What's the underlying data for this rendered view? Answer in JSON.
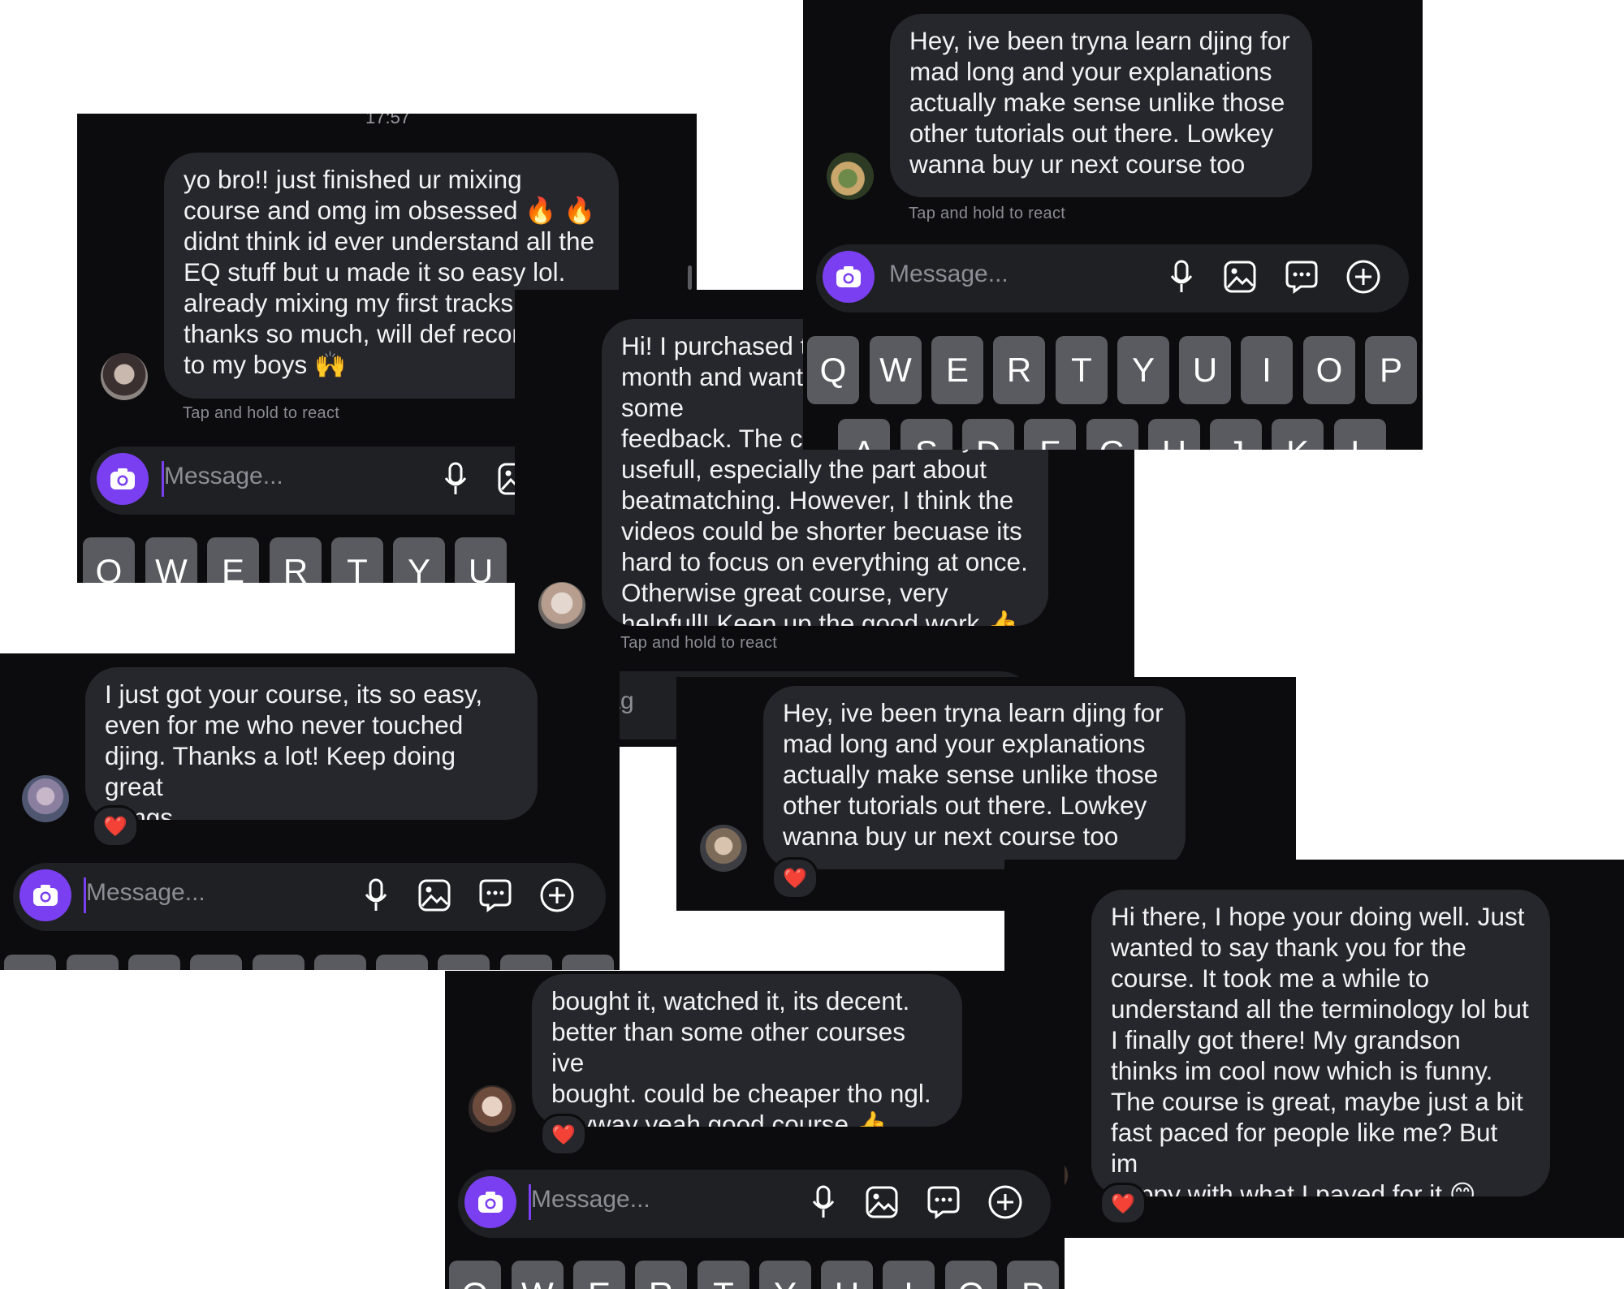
{
  "messages": [
    {
      "text": "yo bro!! just finished ur mixing\ncourse and omg im obsessed 🔥 🔥\ndidnt think id ever understand all the\nEQ stuff but u made it so easy lol.\nalready mixing my first tracks!\nthanks so much, will def recommend\nto my boys 🙌",
      "footer": "Tap and hold to react",
      "time": "17:57"
    },
    {
      "text": "Hey, ive been tryna learn djing for\nmad long and your explanations\nactually make sense unlike those\nother tutorials out there. Lowkey\nwanna buy ur next course too",
      "footer": "Tap and hold to react"
    },
    {
      "text": "Hi! I purchased the course last\nmonth and wanted to give you some\nfeedback. The course was very\nusefull, especially the part about\nbeatmatching. However, I think the\nvideos could be shorter becuase its\nhard to focus on everything at once.\nOtherwise great course, very\nhelpfull! Keep up the good work 👍",
      "footer": "Tap and hold to react"
    },
    {
      "text": "I just got your course, its so easy,\neven for me who never touched\ndjing. Thanks a lot! Keep doing great\nthings",
      "reaction": "❤️"
    },
    {
      "text": "Hey, ive been tryna learn djing for\nmad long and your explanations\nactually make sense unlike those\nother tutorials out there. Lowkey\nwanna buy ur next course too",
      "reaction": "❤️"
    },
    {
      "text": "bought it, watched it, its decent.\nbetter than some other courses ive\nbought. could be cheaper tho ngl.\nanyway yeah good course 👍",
      "reaction": "❤️"
    },
    {
      "text": "Hi there, I hope your doing well. Just\nwanted to say thank you for the\ncourse. It took me a while to\nunderstand all the terminology lol but\nI finally got there! My grandson\nthinks im cool now which is funny.\nThe course is great, maybe just a bit\nfast paced for people like me? But im\nhappy with what I payed for it 😊",
      "reaction": "❤️"
    }
  ],
  "composer": {
    "placeholder": "Message...",
    "placeholder_partial": "lessag"
  },
  "keyboard": {
    "row1": [
      "Q",
      "W",
      "E",
      "R",
      "T",
      "Y",
      "U",
      "I",
      "O",
      "P"
    ],
    "row2": [
      "A",
      "S",
      "D",
      "F",
      "G",
      "H",
      "J",
      "K",
      "L"
    ]
  },
  "icons": [
    "camera-icon",
    "microphone-icon",
    "gallery-icon",
    "sticker-icon",
    "plus-circle-icon",
    "heart-reaction"
  ],
  "colors": {
    "accent": "#7a3ff0",
    "bubble": "#26272c",
    "background": "#0c0c0e",
    "heart": "#e8283b"
  }
}
